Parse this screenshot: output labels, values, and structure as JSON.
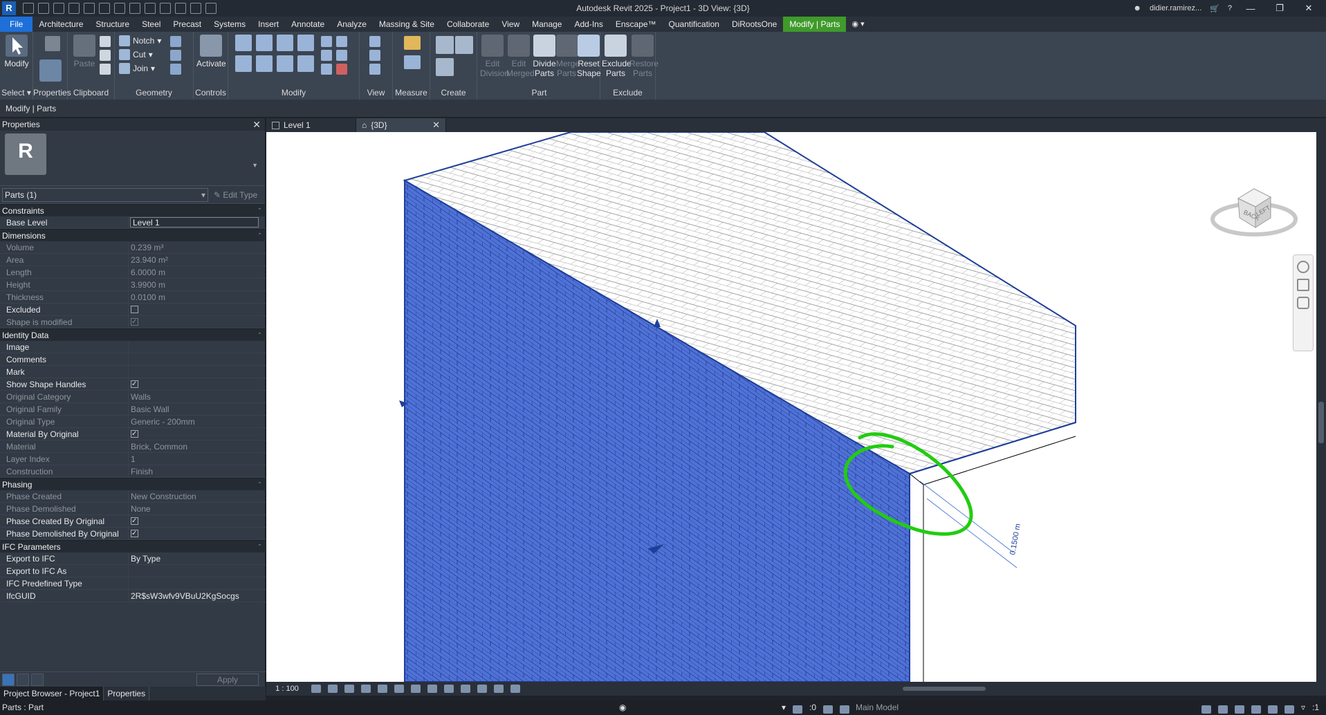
{
  "app": {
    "window_title": "Autodesk Revit 2025 - Project1 - 3D View: {3D}",
    "user": "didier.ramirez...",
    "logo": "R"
  },
  "menu": {
    "tabs": [
      "File",
      "Architecture",
      "Structure",
      "Steel",
      "Precast",
      "Systems",
      "Insert",
      "Annotate",
      "Analyze",
      "Massing & Site",
      "Collaborate",
      "View",
      "Manage",
      "Add-Ins",
      "Enscape™",
      "Quantification",
      "DiRootsOne",
      "Modify | Parts"
    ],
    "active_tab": "Modify | Parts"
  },
  "ribbon": {
    "select": {
      "modify": "Modify",
      "label": "Select"
    },
    "properties": {
      "label": "Properties"
    },
    "clipboard": {
      "paste": "Paste",
      "label": "Clipboard"
    },
    "geometry": {
      "notch": "Notch",
      "cut": "Cut",
      "join": "Join",
      "label": "Geometry"
    },
    "controls": {
      "activate": "Activate",
      "label": "Controls"
    },
    "modify": {
      "label": "Modify"
    },
    "view": {
      "label": "View"
    },
    "measure": {
      "label": "Measure"
    },
    "create": {
      "label": "Create"
    },
    "part": {
      "edit_division": "Edit Division",
      "edit_merged": "Edit Merged",
      "divide_parts": "Divide Parts",
      "merge_parts": "Merge Parts",
      "reset_shape": "Reset Shape",
      "label": "Part"
    },
    "exclude": {
      "exclude_parts": "Exclude Parts",
      "restore_parts": "Restore Parts",
      "label": "Exclude"
    }
  },
  "options_bar": {
    "context": "Modify | Parts"
  },
  "properties": {
    "title": "Properties",
    "type_logo": "R",
    "selector": "Parts (1)",
    "edit_type": "Edit Type",
    "groups": [
      {
        "name": "Constraints",
        "rows": [
          {
            "k": "Base Level",
            "v": "Level 1",
            "mode": "edit"
          }
        ]
      },
      {
        "name": "Dimensions",
        "rows": [
          {
            "k": "Volume",
            "v": "0.239 m³",
            "mode": "ro"
          },
          {
            "k": "Area",
            "v": "23.940 m²",
            "mode": "ro"
          },
          {
            "k": "Length",
            "v": "6.0000 m",
            "mode": "ro"
          },
          {
            "k": "Height",
            "v": "3.9900 m",
            "mode": "ro"
          },
          {
            "k": "Thickness",
            "v": "0.0100 m",
            "mode": "ro"
          },
          {
            "k": "Excluded",
            "v": "",
            "mode": "cb-off"
          },
          {
            "k": "Shape is modified",
            "v": "",
            "mode": "cb-dim-on"
          }
        ]
      },
      {
        "name": "Identity Data",
        "rows": [
          {
            "k": "Image",
            "v": "",
            "mode": "rw"
          },
          {
            "k": "Comments",
            "v": "",
            "mode": "rw"
          },
          {
            "k": "Mark",
            "v": "",
            "mode": "rw"
          },
          {
            "k": "Show Shape Handles",
            "v": "",
            "mode": "cb-on"
          },
          {
            "k": "Original Category",
            "v": "Walls",
            "mode": "ro"
          },
          {
            "k": "Original Family",
            "v": "Basic Wall",
            "mode": "ro"
          },
          {
            "k": "Original Type",
            "v": "Generic - 200mm",
            "mode": "ro"
          },
          {
            "k": "Material By Original",
            "v": "",
            "mode": "cb-on"
          },
          {
            "k": "Material",
            "v": "Brick, Common",
            "mode": "ro"
          },
          {
            "k": "Layer Index",
            "v": "1",
            "mode": "ro"
          },
          {
            "k": "Construction",
            "v": "Finish",
            "mode": "ro"
          }
        ]
      },
      {
        "name": "Phasing",
        "rows": [
          {
            "k": "Phase Created",
            "v": "New Construction",
            "mode": "ro"
          },
          {
            "k": "Phase Demolished",
            "v": "None",
            "mode": "ro"
          },
          {
            "k": "Phase Created By Original",
            "v": "",
            "mode": "cb-on"
          },
          {
            "k": "Phase Demolished By Original",
            "v": "",
            "mode": "cb-on"
          }
        ]
      },
      {
        "name": "IFC Parameters",
        "rows": [
          {
            "k": "Export to IFC",
            "v": "By Type",
            "mode": "rw"
          },
          {
            "k": "Export to IFC As",
            "v": "",
            "mode": "rw"
          },
          {
            "k": "IFC Predefined Type",
            "v": "",
            "mode": "rw"
          },
          {
            "k": "IfcGUID",
            "v": "2R$sW3wfv9VBuU2KgSocgs",
            "mode": "rw"
          }
        ]
      }
    ],
    "apply": "Apply"
  },
  "browser_tabs": [
    "Project Browser - Project1",
    "Properties"
  ],
  "view_tabs": [
    {
      "label": "Level 1",
      "icon": "floor-plan-icon"
    },
    {
      "label": "{3D}",
      "icon": "house-icon"
    }
  ],
  "viewport": {
    "dimension_label": "0.1500 m",
    "viewcube": {
      "back": "BACK",
      "left": "LEFT"
    },
    "annotation_color": "#22cc11",
    "selection_color": "#4f72d6"
  },
  "view_control": {
    "scale": "1 : 100"
  },
  "status": {
    "text": "Parts : Part",
    "workset_count": ":0",
    "model": "Main Model",
    "filter_count": ":1"
  }
}
